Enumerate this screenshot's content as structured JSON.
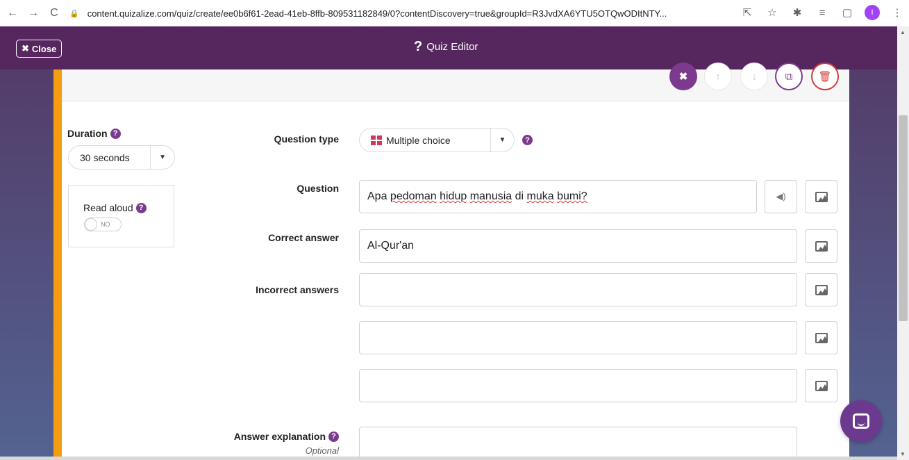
{
  "browser": {
    "url": "content.quizalize.com/quiz/create/ee0b6f61-2ead-41eb-8ffb-809531182849/0?contentDiscovery=true&groupId=R3JvdXA6YTU5OTQwODItNTY...",
    "profile_initial": "I"
  },
  "header": {
    "close_label": "Close",
    "title": "Quiz Editor"
  },
  "settings": {
    "duration_label": "Duration",
    "duration_value": "30 seconds",
    "read_aloud_label": "Read aloud",
    "read_aloud_toggle": "NO"
  },
  "form": {
    "question_type_label": "Question type",
    "question_type_value": "Multiple choice",
    "question_label": "Question",
    "question_value": "Apa pedoman hidup manusia di muka bumi?",
    "question_words": [
      "Apa",
      "pedoman",
      "hidup",
      "manusia",
      "di",
      "muka",
      "bumi?"
    ],
    "correct_answer_label": "Correct answer",
    "correct_answer_value": "Al-Qur'an",
    "incorrect_answers_label": "Incorrect answers",
    "incorrect_answers": [
      "",
      "",
      ""
    ],
    "answer_explanation_label": "Answer explanation",
    "optional_label": "Optional"
  },
  "colors": {
    "header": "#56275f",
    "accent_bar": "#f59c10",
    "primary": "#7c3a8f",
    "danger": "#d33a3a",
    "mc_icon": "#d3365b"
  }
}
